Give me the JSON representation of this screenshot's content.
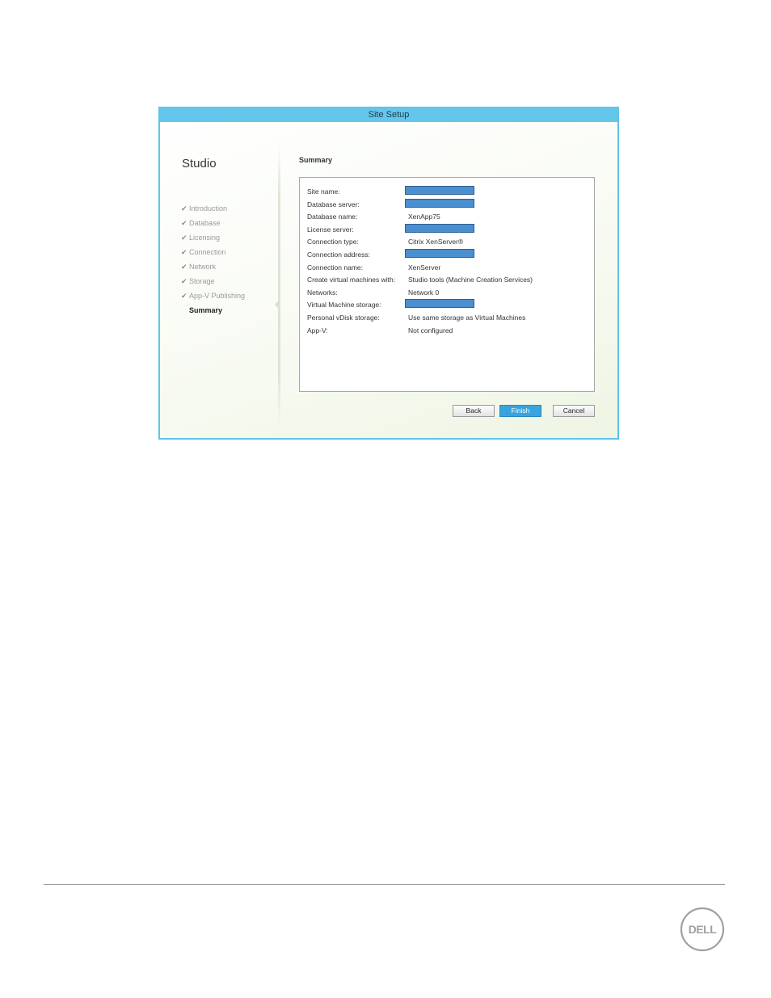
{
  "window": {
    "title": "Site Setup"
  },
  "sidebar": {
    "title": "Studio",
    "steps": [
      {
        "label": "Introduction",
        "completed": true
      },
      {
        "label": "Database",
        "completed": true
      },
      {
        "label": "Licensing",
        "completed": true
      },
      {
        "label": "Connection",
        "completed": true
      },
      {
        "label": "Network",
        "completed": true
      },
      {
        "label": "Storage",
        "completed": true
      },
      {
        "label": "App-V Publishing",
        "completed": true
      },
      {
        "label": "Summary",
        "completed": false,
        "current": true
      }
    ]
  },
  "main": {
    "title": "Summary",
    "rows": [
      {
        "label": "Site name:",
        "value": "",
        "redacted": true
      },
      {
        "label": "Database server:",
        "value": "",
        "redacted": true
      },
      {
        "label": "Database name:",
        "value": "XenApp75"
      },
      {
        "label": "License server:",
        "value": "",
        "redacted": true
      },
      {
        "label": "Connection type:",
        "value": "Citrix XenServer®"
      },
      {
        "label": "Connection address:",
        "value": "",
        "redacted": true
      },
      {
        "label": "Connection name:",
        "value": "XenServer"
      },
      {
        "label": "Create virtual machines with:",
        "value": "Studio tools (Machine Creation Services)"
      },
      {
        "label": "Networks:",
        "value": "Network 0"
      },
      {
        "label": "Virtual Machine storage:",
        "value": "",
        "redacted": true
      },
      {
        "label": "Personal vDisk storage:",
        "value": "Use same storage as Virtual Machines"
      },
      {
        "label": "App-V:",
        "value": "Not configured"
      }
    ]
  },
  "buttons": {
    "back": "Back",
    "finish": "Finish",
    "cancel": "Cancel"
  },
  "colors": {
    "titlebar": "#63c6ea",
    "finish_button": "#39a3dd",
    "redaction": "#4a8fcf"
  },
  "footer": {
    "logo": "DELL"
  }
}
